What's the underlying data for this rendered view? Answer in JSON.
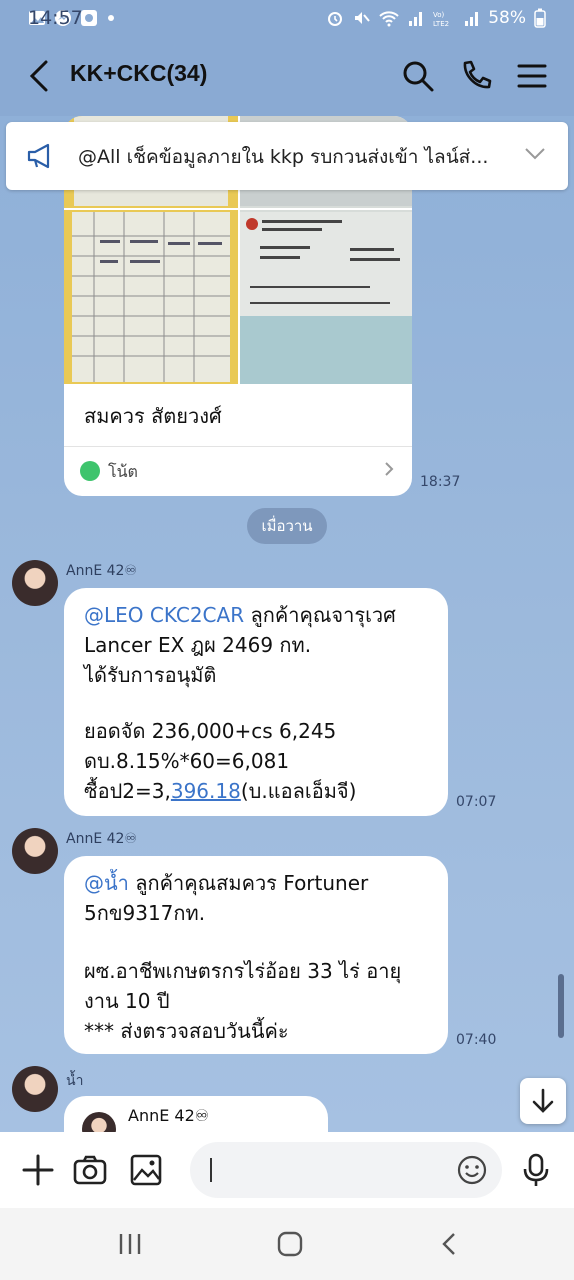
{
  "status": {
    "time": "14:57",
    "battery": "58%"
  },
  "header": {
    "title": "KK+CKC(34)"
  },
  "announcement": {
    "text": "@All  เช็คข้อมูลภายใน kkp รบกวนส่งเข้า ไลน์ส่..."
  },
  "note": {
    "sender": "สมควร สัตยวงศ์",
    "label": "โน้ต",
    "time": "18:37"
  },
  "date_divider": "เมื่อวาน",
  "messages": [
    {
      "sender": "AnnE 42♾",
      "mention": "@LEO CKC2CAR",
      "line1": " ลูกค้าคุณจารุเวศ",
      "line2": "Lancer EX ฎผ 2469 กท.",
      "line3": "ได้รับการอนุมัติ",
      "line5": "ยอดจัด 236,000+cs 6,245",
      "line6": "ดบ.8.15%*60=6,081",
      "line7_prefix": "ซื้อป2=3,",
      "line7_link": "396.18",
      "line7_suffix": "(บ.แอลเอ็มจี)",
      "time": "07:07"
    },
    {
      "sender": "AnnE 42♾",
      "mention": "@น้ำ",
      "line1": " ลูกค้าคุณสมควร Fortuner",
      "line2": "5กข9317กท.",
      "line4": "ผซ.อาชีพเกษตรกรไร่อ้อย 33 ไร่ อายุ",
      "line5": "งาน 10 ปี",
      "line6": "*** ส่งตรวจสอบวันนี้ค่ะ",
      "time": "07:40"
    },
    {
      "sender": "น้ำ",
      "quote_name": "AnnE 42♾"
    }
  ]
}
